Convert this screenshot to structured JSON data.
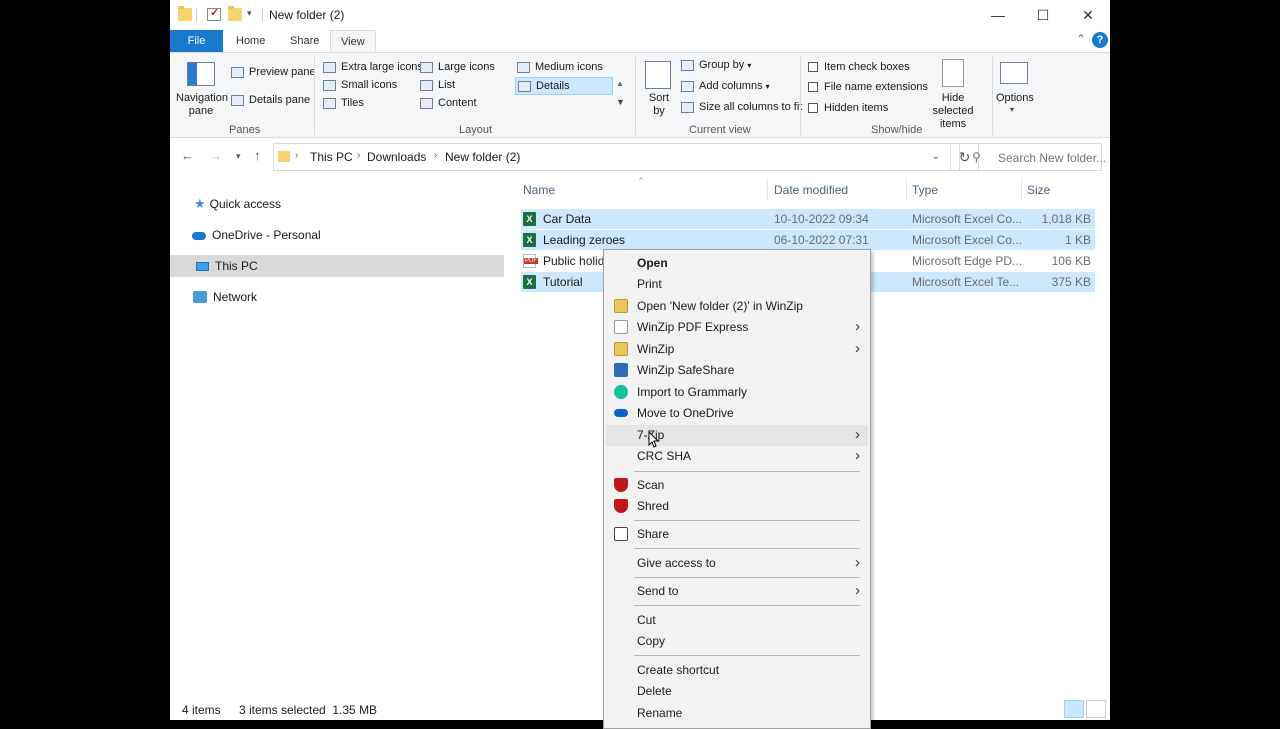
{
  "window": {
    "title": "New folder (2)",
    "controls": {
      "minimize": "—",
      "maximize": "☐",
      "close": "✕"
    }
  },
  "ribbon": {
    "tabs": [
      "File",
      "Home",
      "Share",
      "View"
    ],
    "active_tab": "View",
    "panes": {
      "navigation_pane": "Navigation pane",
      "preview_pane": "Preview pane",
      "details_pane": "Details pane",
      "label": "Panes"
    },
    "layout": {
      "items": [
        "Extra large icons",
        "Large icons",
        "Medium icons",
        "Small icons",
        "List",
        "Details",
        "Tiles",
        "Content"
      ],
      "selected": "Details",
      "label": "Layout"
    },
    "current_view": {
      "sort_by": "Sort by",
      "group_by": "Group by",
      "add_columns": "Add columns",
      "size_all_columns": "Size all columns to fit",
      "label": "Current view"
    },
    "show_hide": {
      "item_check_boxes": "Item check boxes",
      "file_name_extensions": "File name extensions",
      "hidden_items": "Hidden items",
      "hide_selected_items": "Hide selected items",
      "label": "Show/hide"
    },
    "options": "Options"
  },
  "address": {
    "path": [
      "This PC",
      "Downloads",
      "New folder (2)"
    ],
    "search_placeholder": "Search New folder..."
  },
  "nav_pane": {
    "items": [
      {
        "label": "Quick access",
        "icon": "star-icon"
      },
      {
        "label": "OneDrive - Personal",
        "icon": "cloud-icon"
      },
      {
        "label": "This PC",
        "icon": "computer-icon",
        "selected": true
      },
      {
        "label": "Network",
        "icon": "network-icon"
      }
    ]
  },
  "file_list": {
    "columns": [
      "Name",
      "Date modified",
      "Type",
      "Size"
    ],
    "rows": [
      {
        "name": "Car Data",
        "date": "10-10-2022 09:34",
        "type": "Microsoft Excel Co...",
        "size": "1,018 KB",
        "icon": "excel-icon",
        "selected": true
      },
      {
        "name": "Leading zeroes",
        "date": "06-10-2022 07:31",
        "type": "Microsoft Excel Co...",
        "size": "1 KB",
        "icon": "excel-icon",
        "selected": true
      },
      {
        "name": "Public holid",
        "date": "",
        "type": "Microsoft Edge PD...",
        "size": "106 KB",
        "icon": "pdf-icon",
        "selected": false
      },
      {
        "name": "Tutorial",
        "date": "",
        "type": "Microsoft Excel Te...",
        "size": "375 KB",
        "icon": "excel-icon",
        "selected": true
      }
    ]
  },
  "status_bar": {
    "item_count": "4 items",
    "selection": "3 items selected  1.35 MB"
  },
  "context_menu": {
    "items": [
      {
        "label": "Open",
        "bold": true
      },
      {
        "label": "Print"
      },
      {
        "label": "Open 'New folder (2)' in WinZip",
        "icon": "winzip-icon"
      },
      {
        "label": "WinZip PDF Express",
        "icon": "winzip-pdf-icon",
        "submenu": true
      },
      {
        "label": "WinZip",
        "icon": "winzip-icon",
        "submenu": true
      },
      {
        "label": "WinZip SafeShare",
        "icon": "safeshare-icon"
      },
      {
        "label": "Import to Grammarly",
        "icon": "grammarly-icon"
      },
      {
        "label": "Move to OneDrive",
        "icon": "onedrive-icon"
      },
      {
        "label": "7-Zip",
        "submenu": true,
        "hover": true
      },
      {
        "label": "CRC SHA",
        "submenu": true
      },
      {
        "label": "Scan",
        "icon": "mcafee-icon"
      },
      {
        "label": "Shred",
        "icon": "mcafee-icon"
      },
      {
        "label": "Share",
        "icon": "share-icon"
      },
      {
        "label": "Give access to",
        "submenu": true
      },
      {
        "label": "Send to",
        "submenu": true
      },
      {
        "label": "Cut"
      },
      {
        "label": "Copy"
      },
      {
        "label": "Create shortcut"
      },
      {
        "label": "Delete"
      },
      {
        "label": "Rename"
      }
    ],
    "submenu_arrow": "›"
  },
  "colors": {
    "accent": "#1979ca",
    "selection": "#cce8ff",
    "excel": "#1d6f42",
    "mcafee": "#c01818",
    "grammarly": "#15c39a",
    "onedrive": "#0a64c8"
  }
}
